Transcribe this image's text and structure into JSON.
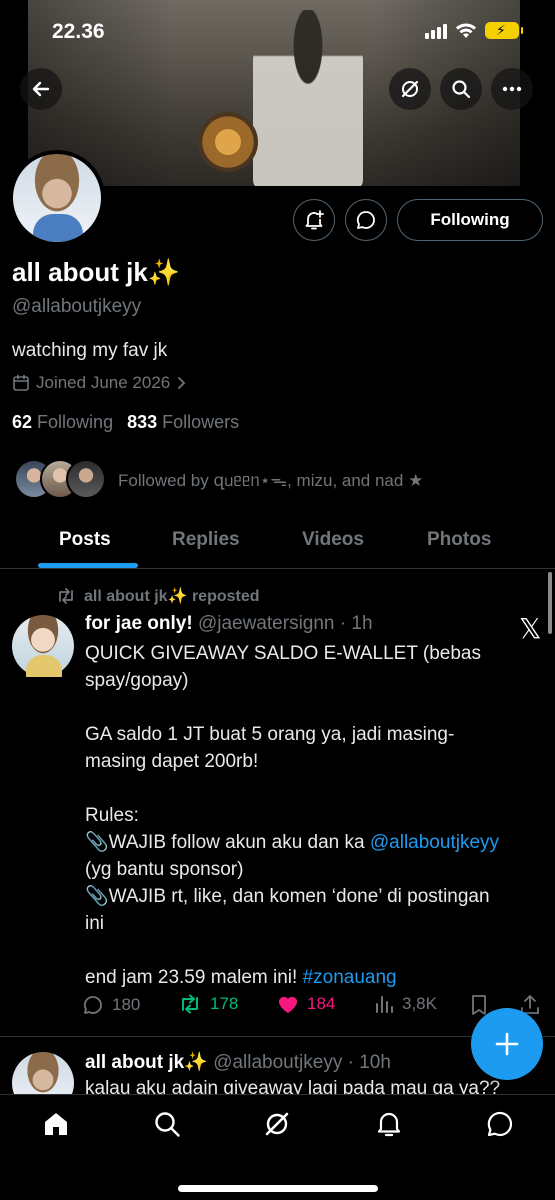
{
  "status_bar": {
    "time": "22.36"
  },
  "header": {
    "back_icon": "arrow-left-icon",
    "grok_icon": "grok-icon",
    "search_icon": "search-icon",
    "more_icon": "more-icon"
  },
  "profile": {
    "display_name": "all about jk✨",
    "handle": "@allaboutjkeyy",
    "bio": "watching my fav jk",
    "joined": "Joined June 2026",
    "following_count": "62",
    "following_label": "Following",
    "followers_count": "833",
    "followers_label": "Followers",
    "followed_by": "Followed by զᥙᥱᥱᥒ⋆ᯓ, mizu, and nad ★",
    "follow_button": "Following"
  },
  "tabs": [
    "Posts",
    "Replies",
    "Videos",
    "Photos"
  ],
  "posts": [
    {
      "repost_label": "all about jk✨ reposted",
      "author_name": "for jae only!",
      "author_handle": "@jaewatersignn",
      "time": "· 1h",
      "lines": [
        "QUICK GIVEAWAY SALDO E-WALLET (bebas",
        "spay/gopay)",
        "",
        "GA saldo 1 JT buat 5 orang ya, jadi masing-",
        "masing dapet 200rb!",
        "",
        "Rules:",
        "📎WAJIB follow akun aku dan ka ",
        "(yg bantu sponsor)",
        "📎WAJIB rt, like, dan komen ‘done’ di postingan",
        "ini",
        "",
        "end jam 23.59 malem ini! "
      ],
      "mention": "@allaboutjkeyy",
      "hashtag": "#zonauang",
      "replies": "180",
      "reposts": "178",
      "likes": "184",
      "views": "3,8K"
    },
    {
      "author_name": "all about jk✨",
      "author_handle": "@allaboutjkeyy",
      "time": "· 10h",
      "text": "kalau aku adain giveaway lagi pada mau ga ya??"
    }
  ],
  "colors": {
    "accent": "#1d9bf0",
    "repost_active": "#00ba7c",
    "like_active": "#f91880",
    "muted": "#71767b",
    "background": "#000000"
  }
}
